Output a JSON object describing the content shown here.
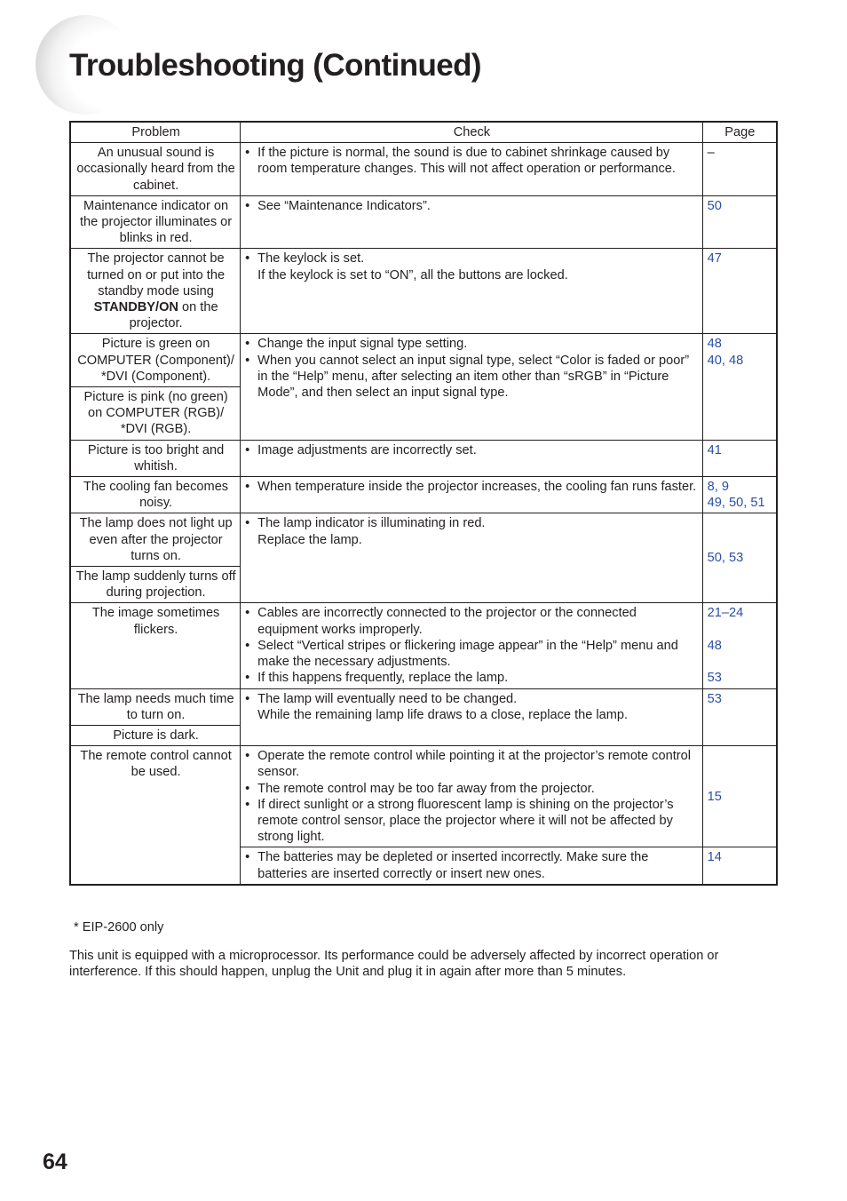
{
  "header": {
    "title": "Troubleshooting (Continued)"
  },
  "table": {
    "headers": {
      "problem": "Problem",
      "check": "Check",
      "page": "Page"
    },
    "rows": [
      {
        "problem": "An unusual sound is occasionally heard from the cabinet.",
        "checks": [
          "If the picture is normal, the sound is due to cabinet shrinkage caused by room temperature changes. This will not affect operation or performance."
        ],
        "page": "–"
      },
      {
        "problem": "Maintenance indicator on the projector illuminates or blinks in red.",
        "checks": [
          "See “Maintenance Indicators”."
        ],
        "page": "50"
      },
      {
        "problem_pre": "The projector cannot be turned on or put into the standby mode using ",
        "problem_bold": "STANDBY/ON",
        "problem_post": " on the projector.",
        "check_main": "The keylock is set.",
        "check_cont": "If the keylock is set to “ON”, all the buttons are locked.",
        "page": "47"
      },
      {
        "problem": "Picture is green on COMPUTER (Component)/ *DVI (Component).",
        "problem_2": "Picture is pink (no green) on COMPUTER (RGB)/ *DVI (RGB).",
        "checks": [
          "Change the input signal type setting.",
          "When you cannot select an input signal type, select “Color is faded or poor” in the “Help” menu, after selecting an item other than “sRGB” in “Picture Mode”, and then select an input signal type."
        ],
        "pages": [
          "48",
          "40, 48"
        ]
      },
      {
        "problem": "Picture is too bright and whitish.",
        "checks": [
          "Image adjustments are incorrectly set."
        ],
        "page": "41"
      },
      {
        "problem": "The cooling fan becomes noisy.",
        "checks": [
          "When temperature inside the projector increases, the cooling fan runs faster."
        ],
        "pages": [
          "8, 9",
          "49, 50, 51"
        ]
      },
      {
        "problem": "The lamp does not light up even after the projector turns on.",
        "problem_2": "The lamp suddenly turns off during projection.",
        "check_main": "The lamp indicator is illuminating in red.",
        "check_cont": "Replace the lamp.",
        "page": "50, 53"
      },
      {
        "problem": "The image sometimes flickers.",
        "checks": [
          "Cables are incorrectly connected to the projector or the connected equipment works improperly.",
          "Select “Vertical stripes or flickering image appear” in the “Help” menu and make the necessary adjustments.",
          "If this happens frequently, replace the lamp."
        ],
        "pages": [
          "21–24",
          "48",
          "53"
        ]
      },
      {
        "problem": "The lamp needs much time to turn on.",
        "problem_2": "Picture is dark.",
        "check_main": "The lamp will eventually need to be changed.",
        "check_cont": "While the remaining lamp life draws to a close, replace the lamp.",
        "page": "53"
      },
      {
        "problem": "The remote control cannot be used.",
        "checks": [
          "Operate the remote control while pointing it at the projector’s remote control sensor.",
          "The remote control may be too far away from the projector.",
          "If direct sunlight or a strong fluorescent lamp is shining on the projector’s remote control sensor, place the projector where it will not be affected by strong light."
        ],
        "page": "15",
        "checks_2": [
          "The batteries may be depleted or inserted incorrectly. Make sure the batteries are inserted correctly or insert new ones."
        ],
        "page_2": "14"
      }
    ]
  },
  "footnote": "* EIP-2600 only",
  "note": "This unit is equipped with a microprocessor. Its performance could be adversely affected by incorrect operation or interference. If this should happen, unplug the Unit and plug it in again after more than 5 minutes.",
  "page_number": "64",
  "colors": {
    "text": "#231f20",
    "page_link": "#2a4fa8"
  }
}
